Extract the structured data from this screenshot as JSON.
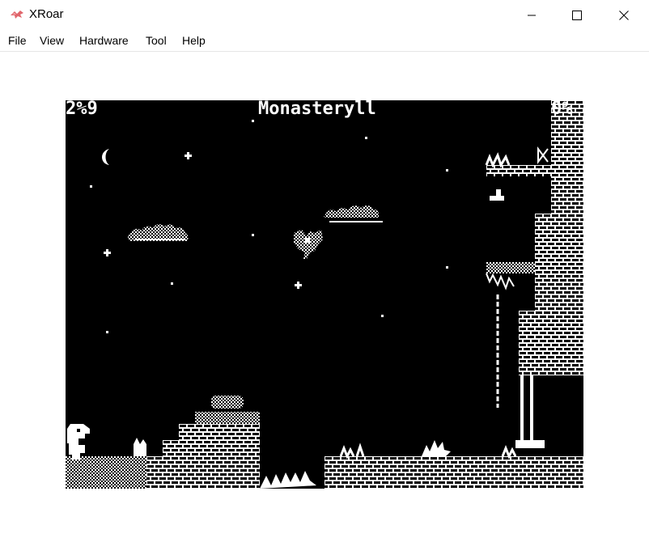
{
  "window": {
    "title": "XRoar",
    "icon": "xroar-dragon-icon",
    "controls": [
      "minimize-icon",
      "maximize-icon",
      "close-icon"
    ]
  },
  "menu": {
    "items": [
      {
        "id": "file",
        "label": "File"
      },
      {
        "id": "view",
        "label": "View"
      },
      {
        "id": "hardware",
        "label": "Hardware"
      },
      {
        "id": "tool",
        "label": "Tool"
      },
      {
        "id": "help",
        "label": "Help"
      }
    ]
  },
  "game": {
    "hud_left": "2%9",
    "room_name": "Monasteryll",
    "hud_right": "0%",
    "colors": {
      "background": "#000000",
      "foreground": "#ffffff"
    }
  }
}
